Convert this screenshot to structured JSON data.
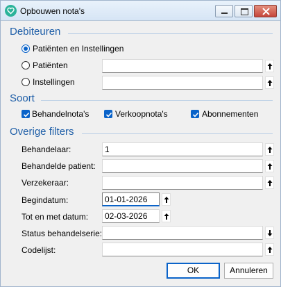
{
  "window": {
    "title": "Opbouwen nota's"
  },
  "debiteuren": {
    "title": "Debiteuren",
    "options": [
      {
        "label": "Patiënten en Instellingen",
        "selected": true
      },
      {
        "label": "Patiënten",
        "selected": false,
        "value": ""
      },
      {
        "label": "Instellingen",
        "selected": false,
        "value": ""
      }
    ]
  },
  "soort": {
    "title": "Soort",
    "options": [
      {
        "label": "Behandelnota's",
        "checked": true
      },
      {
        "label": "Verkoopnota's",
        "checked": true
      },
      {
        "label": "Abonnementen",
        "checked": true
      }
    ]
  },
  "filters": {
    "title": "Overige filters",
    "fields": [
      {
        "label": "Behandelaar:",
        "value": "1",
        "arrow": "up"
      },
      {
        "label": "Behandelde patient:",
        "value": "",
        "arrow": "up"
      },
      {
        "label": "Verzekeraar:",
        "value": "",
        "arrow": "up"
      },
      {
        "label": "Begindatum:",
        "value": "01-01-2026",
        "arrow": "up"
      },
      {
        "label": "Tot en met datum:",
        "value": "02-03-2026",
        "arrow": "up"
      },
      {
        "label": "Status behandelserie:",
        "value": "",
        "arrow": "down"
      },
      {
        "label": "Codelijst:",
        "value": "",
        "arrow": "up"
      }
    ]
  },
  "buttons": {
    "ok": "OK",
    "cancel": "Annuleren"
  },
  "colors": {
    "accent": "#0a63c9",
    "section_title": "#1f5fa8",
    "app_icon": "#2bb39a",
    "close": "#c5453b"
  }
}
